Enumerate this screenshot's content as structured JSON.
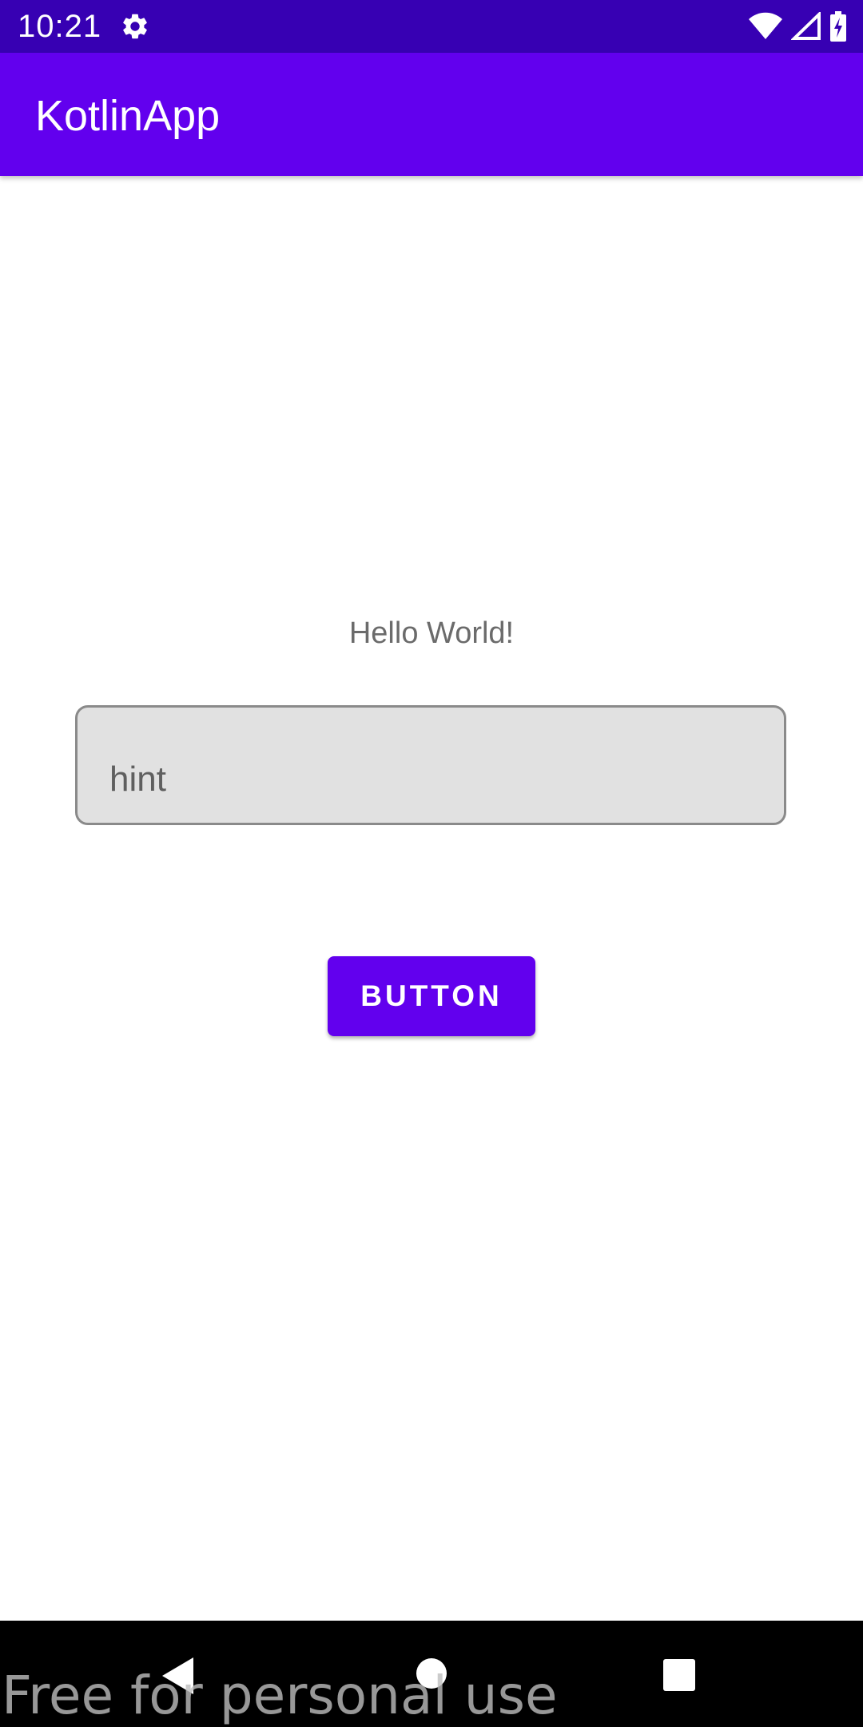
{
  "status_bar": {
    "time": "10:21",
    "icons": [
      "settings-icon",
      "wifi-icon",
      "cell-signal-icon",
      "battery-charging-icon"
    ]
  },
  "app_bar": {
    "title": "KotlinApp"
  },
  "content": {
    "greeting": "Hello World!",
    "text_field": {
      "value": "",
      "placeholder": "hint"
    },
    "button_label": "BUTTON"
  },
  "nav_bar": {
    "icons": [
      "back-icon",
      "home-icon",
      "recents-icon"
    ]
  },
  "watermark": "Free for personal use",
  "colors": {
    "status_bar": "#3700b3",
    "primary": "#6200ee",
    "text_secondary": "#6b6b6b",
    "field_background": "#e1e1e1"
  }
}
